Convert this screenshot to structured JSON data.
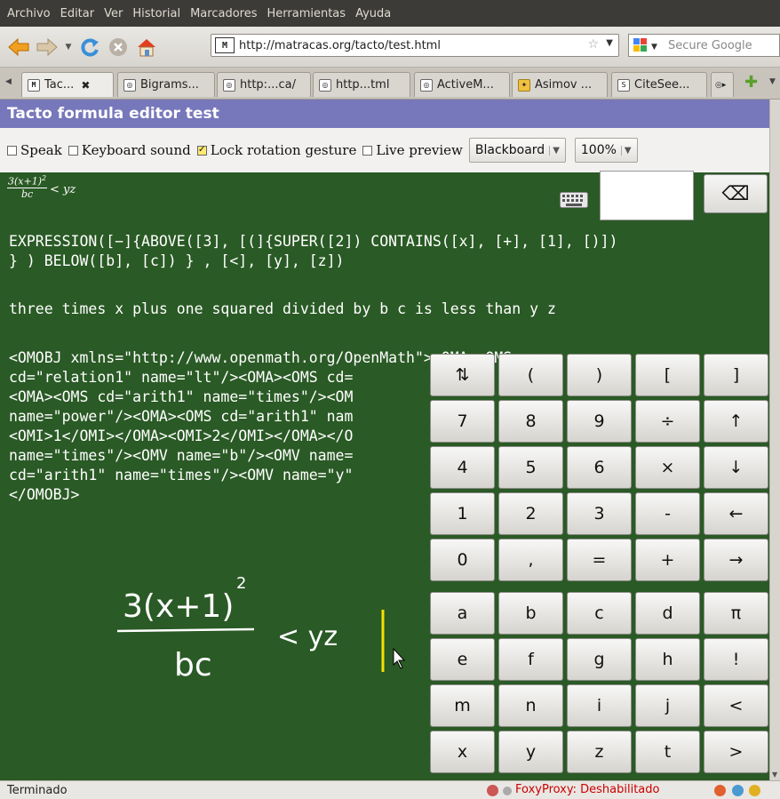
{
  "menubar": {
    "items": [
      "Archivo",
      "Editar",
      "Ver",
      "Historial",
      "Marcadores",
      "Herramientas",
      "Ayuda"
    ]
  },
  "navbar": {
    "url": "http://matracas.org/tacto/test.html",
    "favicon": "M",
    "search_placeholder": "Secure Google"
  },
  "tabs": [
    {
      "label": "Tac...",
      "favicon": "M",
      "active": true
    },
    {
      "label": "Bigrams..."
    },
    {
      "label": "http:...ca/"
    },
    {
      "label": "http...tml"
    },
    {
      "label": "ActiveM..."
    },
    {
      "label": "Asimov ..."
    },
    {
      "label": "CiteSee..."
    }
  ],
  "page": {
    "title": "Tacto formula editor test",
    "options": {
      "speak": {
        "label": "Speak",
        "checked": false
      },
      "keyboard_sound": {
        "label": "Keyboard sound",
        "checked": false
      },
      "lock_rotation": {
        "label": "Lock rotation gesture",
        "checked": true
      },
      "live_preview": {
        "label": "Live preview",
        "checked": false
      },
      "theme_select": "Blackboard",
      "zoom_select": "100%"
    },
    "small_formula": {
      "numerator": "3(x+1)",
      "exponent": "2",
      "denominator": "bc",
      "rest": "< yz"
    },
    "backspace_symbol": "⌫",
    "expression_lines": [
      "EXPRESSION([−]{ABOVE([3], [(]{SUPER([2]) CONTAINS([x], [+], [1], [)])",
      "} ) BELOW([b], [c]) } , [<], [y], [z])"
    ],
    "speech": "three times x plus one squared divided by b c is less than y z",
    "omobj_lines": [
      "<OMOBJ xmlns=\"http://www.openmath.org/OpenMath\"><OMA><OMS",
      "cd=\"relation1\" name=\"lt\"/><OMA><OMS cd=",
      "<OMA><OMS cd=\"arith1\" name=\"times\"/><OM",
      "name=\"power\"/><OMA><OMS cd=\"arith1\" nam",
      "<OMI>1</OMI></OMA><OMI>2</OMI></OMA></O",
      "name=\"times\"/><OMV name=\"b\"/><OMV name=",
      "cd=\"arith1\" name=\"times\"/><OMV name=\"y\"",
      "</OMOBJ>"
    ],
    "handwriting": {
      "numerator": "3(x+1)",
      "exponent": "2",
      "denominator": "bc",
      "rest": "< yz"
    }
  },
  "keypad": {
    "rows": [
      [
        "⇅",
        "(",
        ")",
        "[",
        "]"
      ],
      [
        "7",
        "8",
        "9",
        "÷",
        "↑"
      ],
      [
        "4",
        "5",
        "6",
        "×",
        "↓"
      ],
      [
        "1",
        "2",
        "3",
        "-",
        "←"
      ],
      [
        "0",
        ",",
        "=",
        "+",
        "→"
      ],
      [
        "a",
        "b",
        "c",
        "d",
        "π"
      ],
      [
        "e",
        "f",
        "g",
        "h",
        "!"
      ],
      [
        "m",
        "n",
        "i",
        "j",
        "<"
      ],
      [
        "x",
        "y",
        "z",
        "t",
        ">"
      ]
    ]
  },
  "statusbar": {
    "status": "Terminado",
    "foxyproxy": "FoxyProxy: Deshabilitado"
  },
  "colors": {
    "blackboard": "#2a5a25",
    "header": "#7777bb",
    "cursor": "#f5e000",
    "foxy": "#cc0000"
  }
}
